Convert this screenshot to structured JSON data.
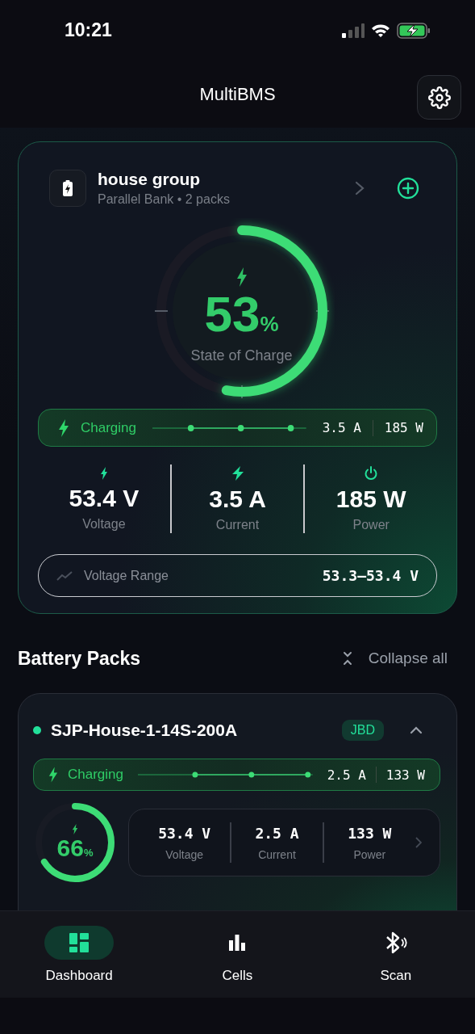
{
  "status_bar": {
    "time": "10:21"
  },
  "header": {
    "title": "MultiBMS"
  },
  "group": {
    "name": "house group",
    "subtitle": "Parallel Bank • 2 packs",
    "soc": {
      "value": "53",
      "unit": "%",
      "label": "State of Charge"
    },
    "flow": {
      "status": "Charging",
      "current": "3.5 A",
      "power": "185 W"
    },
    "metrics": [
      {
        "kind": "voltage",
        "value": "53.4 V",
        "label": "Voltage"
      },
      {
        "kind": "current",
        "value": "3.5 A",
        "label": "Current"
      },
      {
        "kind": "power",
        "value": "185 W",
        "label": "Power"
      }
    ],
    "range": {
      "label": "Voltage Range",
      "value": "53.3–53.4 V"
    }
  },
  "packs_section": {
    "title": "Battery Packs",
    "action": "Collapse all"
  },
  "packs": [
    {
      "name": "SJP-House-1-14S-200A",
      "online": true,
      "badge": "JBD",
      "expanded": true,
      "flow": {
        "status": "Charging",
        "current": "2.5 A",
        "power": "133 W"
      },
      "soc": {
        "value": "66",
        "unit": "%"
      },
      "metrics": [
        {
          "value": "53.4 V",
          "label": "Voltage"
        },
        {
          "value": "2.5 A",
          "label": "Current"
        },
        {
          "value": "133 W",
          "label": "Power"
        }
      ]
    }
  ],
  "tabs": [
    {
      "kind": "dashboard",
      "label": "Dashboard",
      "selected": true
    },
    {
      "kind": "cells",
      "label": "Cells",
      "selected": false
    },
    {
      "kind": "scan",
      "label": "Scan",
      "selected": false
    }
  ]
}
